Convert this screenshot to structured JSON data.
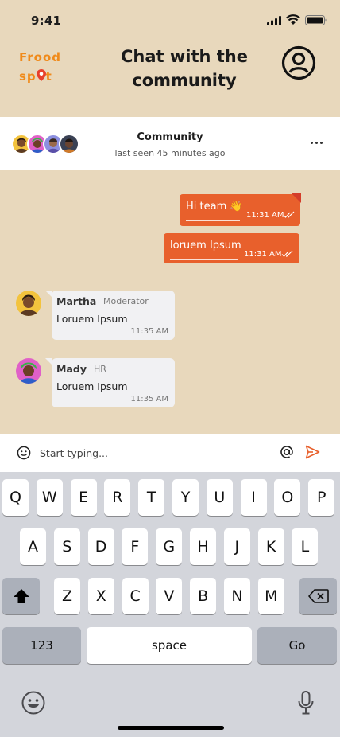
{
  "status_bar": {
    "time": "9:41"
  },
  "header": {
    "logo_line1": "Frood",
    "logo_line2_a": "sp",
    "logo_line2_b": "t",
    "title": "Chat with the community",
    "colors": {
      "logo": "#F08A1A",
      "background": "#E8D8BC"
    }
  },
  "community": {
    "name": "Community",
    "last_seen": "last seen 45 minutes ago"
  },
  "messages": [
    {
      "direction": "out",
      "text": "Hi team 👋",
      "time": "11:31 AM"
    },
    {
      "direction": "out",
      "text": "loruem Ipsum",
      "time": "11:31 AM"
    },
    {
      "direction": "in",
      "sender": "Martha",
      "role": "Moderator",
      "text": "Loruem Ipsum",
      "time": "11:35 AM"
    },
    {
      "direction": "in",
      "sender": "Mady",
      "role": "HR",
      "text": "Loruem Ipsum",
      "time": "11:35 AM"
    }
  ],
  "composer": {
    "placeholder": "Start typing..."
  },
  "keyboard": {
    "row1": [
      "Q",
      "W",
      "E",
      "R",
      "T",
      "Y",
      "U",
      "I",
      "O",
      "P"
    ],
    "row2": [
      "A",
      "S",
      "D",
      "F",
      "G",
      "H",
      "J",
      "K",
      "L"
    ],
    "row3": [
      "Z",
      "X",
      "C",
      "V",
      "B",
      "N",
      "M"
    ],
    "numbers_label": "123",
    "space_label": "space",
    "go_label": "Go"
  },
  "colors": {
    "accent": "#E8602C",
    "incoming_bubble": "#F1F1F3"
  }
}
